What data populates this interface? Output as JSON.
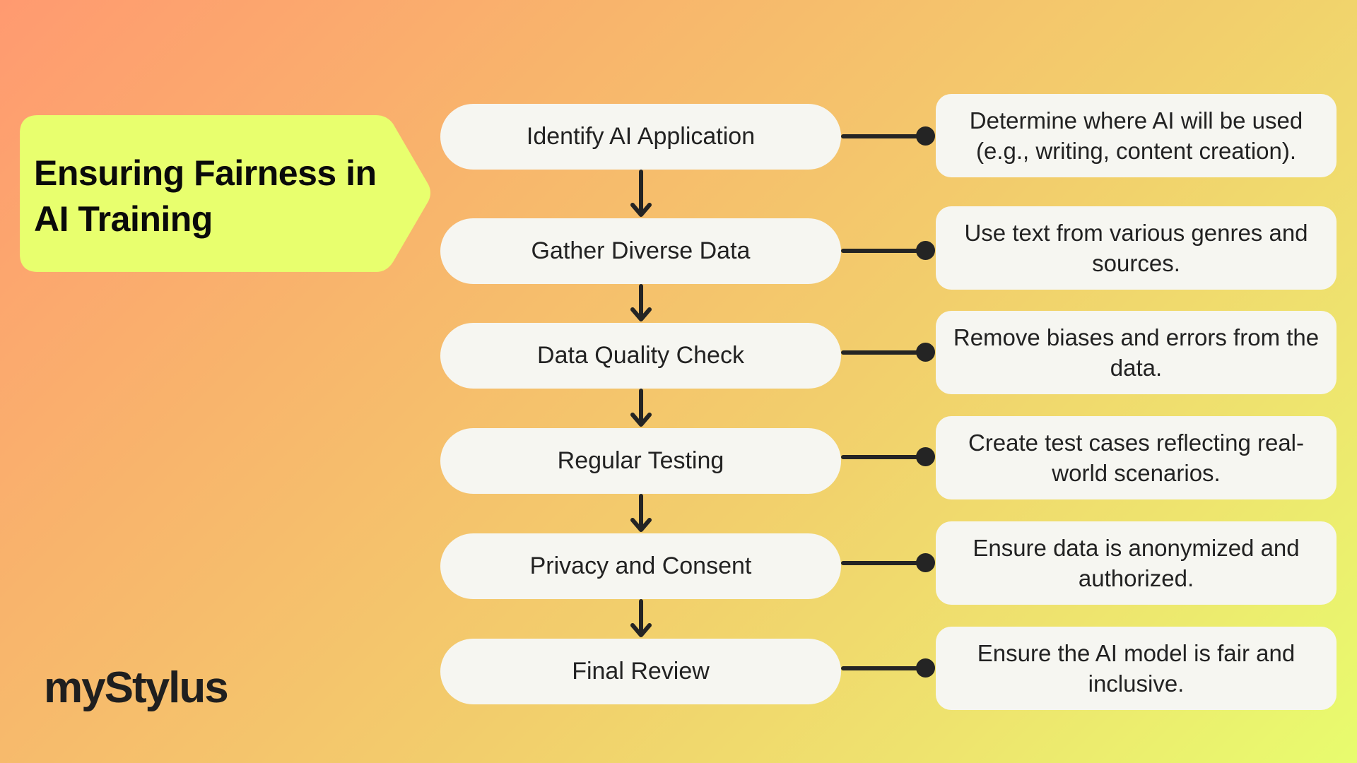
{
  "title": "Ensuring Fairness in AI Training",
  "colors": {
    "background_start": "#FF9A70",
    "background_end": "#E8FC6E",
    "title_fill": "#E8FF6E",
    "box_fill": "#F6F6F1",
    "connector": "#242424"
  },
  "steps": [
    {
      "label": "Identify AI Application",
      "description": "Determine where AI will be used (e.g., writing, content creation)."
    },
    {
      "label": "Gather Diverse Data",
      "description": "Use text from various genres and sources."
    },
    {
      "label": "Data Quality Check",
      "description": "Remove biases and errors from the data."
    },
    {
      "label": "Regular Testing",
      "description": "Create test cases reflecting real-world scenarios."
    },
    {
      "label": "Privacy and Consent",
      "description": "Ensure data is anonymized and authorized."
    },
    {
      "label": "Final Review",
      "description": "Ensure the AI model is fair and inclusive."
    }
  ],
  "logo": "myStylus"
}
